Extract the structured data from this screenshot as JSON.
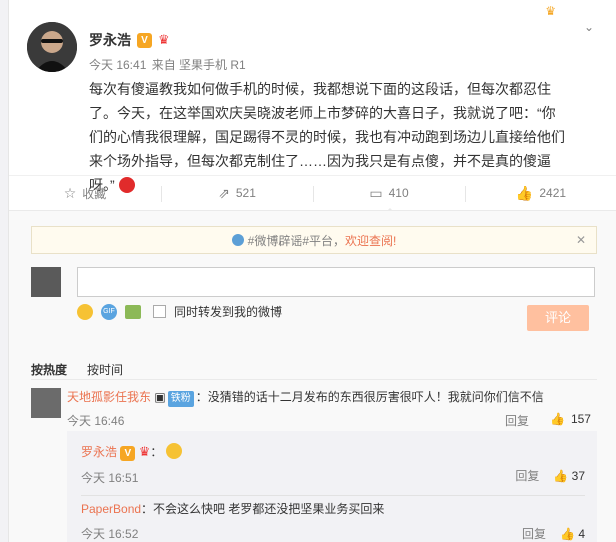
{
  "post": {
    "author": "罗永浩",
    "time": "今天 16:41",
    "source": "来自 坚果手机 R1",
    "content": "每次有傻逼教我如何做手机的时候，我都想说下面的这段话，但每次都忍住了。今天，在这举国欢庆吴晓波老师上市梦碎的大喜日子，我就说了吧：“你们的心情我很理解，国足踢得不灵的时候，我也有冲动跑到场边儿直接给他们来个场外指导，但每次都克制住了……因为我只是有点傻，并不是真的傻逼呀。”"
  },
  "actions": {
    "favorite": "收藏",
    "repost": "521",
    "comment": "410",
    "like": "2421"
  },
  "notice": {
    "prefix": "#微博辟谣#平台，",
    "link": "欢迎查阅!"
  },
  "compose": {
    "repost_checkbox": "同时转发到我的微博",
    "submit": "评论"
  },
  "sort": {
    "by_hot": "按热度",
    "by_time": "按时间"
  },
  "comments": [
    {
      "user": "天地孤影任我东",
      "badge": "铁粉",
      "text": "：没猜错的话十二月发布的东西很厉害很吓人！我就问你们信不信",
      "time": "今天 16:46",
      "reply": "回复",
      "likes": "157"
    }
  ],
  "replies": [
    {
      "user": "罗永浩",
      "text": "：",
      "time": "今天 16:51",
      "reply": "回复",
      "likes": "37"
    },
    {
      "user": "PaperBond",
      "text": "：不会这么快吧 老罗都还没把坚果业务买回来",
      "time": "今天 16:52",
      "reply": "回复",
      "likes": "4"
    }
  ],
  "icons": {
    "verified": "V",
    "gif": "GIF"
  },
  "colors": {
    "accent": "#eb7350",
    "submit_bg": "#ffc09f",
    "notice_bg": "#fffbef"
  }
}
